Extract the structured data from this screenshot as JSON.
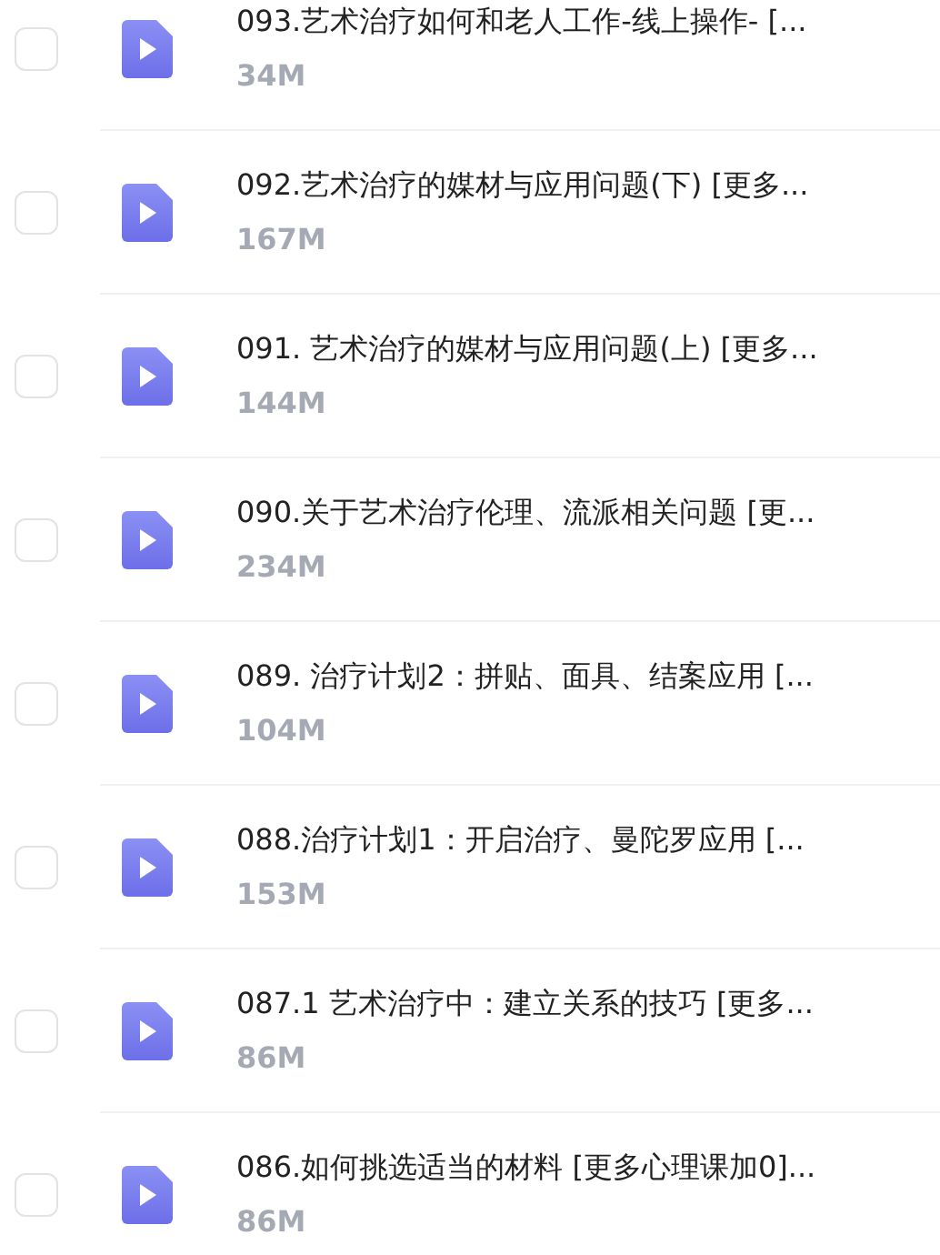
{
  "files": [
    {
      "title": "093.艺术治疗如何和老人工作-线上操作- [...",
      "size": "34M",
      "checked": false
    },
    {
      "title": "092.艺术治疗的媒材与应用问题(下) [更多...",
      "size": "167M",
      "checked": false
    },
    {
      "title": "091. 艺术治疗的媒材与应用问题(上) [更多...",
      "size": "144M",
      "checked": false
    },
    {
      "title": "090.关于艺术治疗伦理、流派相关问题 [更...",
      "size": "234M",
      "checked": false
    },
    {
      "title": "089. 治疗计划2：拼贴、面具、结案应用 [...",
      "size": "104M",
      "checked": false
    },
    {
      "title": "088.治疗计划1：开启治疗、曼陀罗应用 [...",
      "size": "153M",
      "checked": false
    },
    {
      "title": "087.1 艺术治疗中：建立关系的技巧 [更多...",
      "size": "86M",
      "checked": false
    },
    {
      "title": "086.如何挑选适当的材料 [更多心理课加0]...",
      "size": "86M",
      "checked": false
    }
  ]
}
